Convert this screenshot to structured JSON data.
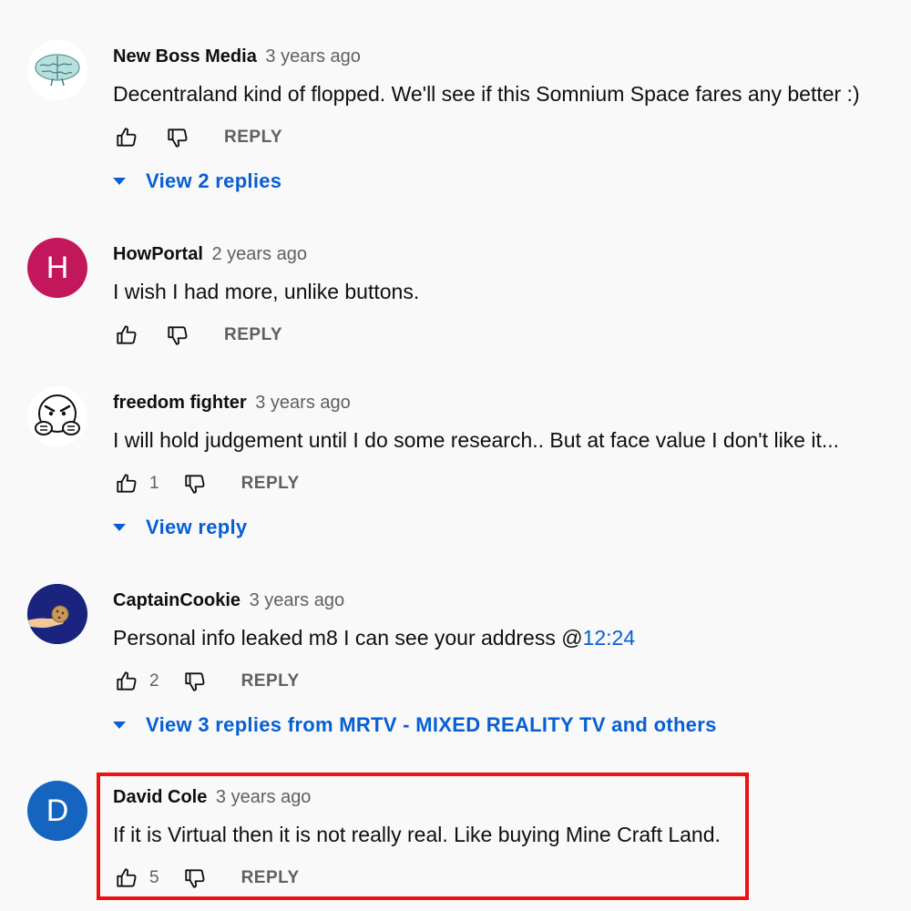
{
  "comments": [
    {
      "author": "New Boss Media",
      "time": "3 years ago",
      "text": "Decentraland kind of flopped. We'll see if this Somnium Space fares any better :)",
      "likes": "",
      "reply_label": "REPLY",
      "view_replies": "View 2 replies",
      "avatar_icon": "brain-icon"
    },
    {
      "author": "HowPortal",
      "time": "2 years ago",
      "text": "I wish I had more, unlike buttons.",
      "likes": "",
      "reply_label": "REPLY",
      "avatar_letter": "H",
      "avatar_color": "#c2185b"
    },
    {
      "author": "freedom fighter",
      "time": "3 years ago",
      "text": "I will hold judgement until I do some research.. But at face value I don't like it...",
      "likes": "1",
      "reply_label": "REPLY",
      "view_replies": "View reply",
      "avatar_icon": "angry-face-icon"
    },
    {
      "author": "CaptainCookie",
      "time": "3 years ago",
      "text_prefix": "Personal info leaked m8 I can see your address @",
      "timestamp_link": "12:24",
      "likes": "2",
      "reply_label": "REPLY",
      "view_replies": "View 3 replies from MRTV - MIXED REALITY TV and others",
      "avatar_icon": "cookie-hand-icon",
      "avatar_color": "#1a237e"
    },
    {
      "author": "David Cole",
      "time": "3 years ago",
      "text": "If it is Virtual then it is not really real. Like buying Mine Craft Land.",
      "likes": "5",
      "reply_label": "REPLY",
      "avatar_letter": "D",
      "avatar_color": "#1565c0",
      "highlighted": true
    }
  ],
  "colors": {
    "link": "#065fd4",
    "highlight_border": "#ee1111",
    "secondary_text": "#606060"
  }
}
